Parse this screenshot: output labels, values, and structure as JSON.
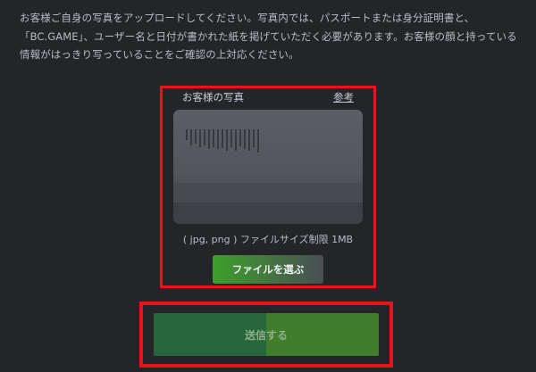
{
  "instructions": {
    "text": "お客様ご自身の写真をアップロードしてください。写真内では、パスポートまたは身分証明書と、「BC.GAME」、ユーザー名と日付が書かれた紙を掲げていただく必要があります。お客様の顔と持っている情報がはっきり写っていることをご確認の上対応ください。"
  },
  "upload": {
    "title": "お客様の写真",
    "reference_link": "参考",
    "file_info": "( jpg, png ) ファイルサイズ制限 1MB",
    "choose_file_label": "ファイルを選ぶ"
  },
  "submit": {
    "label": "送信する",
    "progress": 0.5
  },
  "colors": {
    "background": "#232529",
    "highlight": "#e8141b",
    "accent_green": "#3da02b",
    "submit_green": "#3f7c2c"
  }
}
